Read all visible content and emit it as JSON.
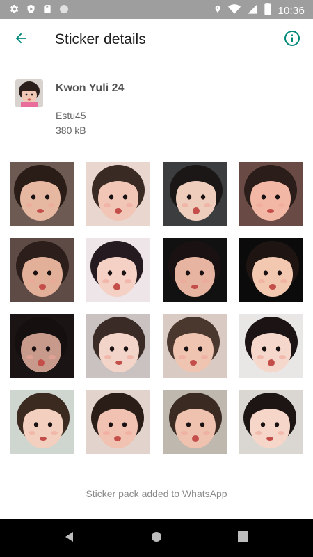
{
  "status_bar": {
    "time": "10:36",
    "left_icons": [
      "gear-icon",
      "shield-icon",
      "sd-card-icon",
      "circle-icon"
    ],
    "right_icons": [
      "location-icon",
      "wifi-icon",
      "signal-icon",
      "battery-icon"
    ]
  },
  "app_bar": {
    "title": "Sticker details",
    "back_icon": "arrow-left-icon",
    "info_icon": "info-icon",
    "accent_color": "#00897b"
  },
  "pack": {
    "name": "Kwon Yuli 24",
    "publisher": "Estu45",
    "size": "380 kB"
  },
  "stickers": [
    {
      "id": 1,
      "bg": "#6d5a52",
      "hair": "#2a1c17",
      "skin": "#e6b7a1"
    },
    {
      "id": 2,
      "bg": "#e8d6cf",
      "hair": "#3a2a24",
      "skin": "#f1c6b6"
    },
    {
      "id": 3,
      "bg": "#3b3d3f",
      "hair": "#1b1716",
      "skin": "#efcdbc"
    },
    {
      "id": 4,
      "bg": "#6a4a44",
      "hair": "#2b1d1a",
      "skin": "#f3b8a5"
    },
    {
      "id": 5,
      "bg": "#5e4b45",
      "hair": "#2c1e1a",
      "skin": "#e2af98"
    },
    {
      "id": 6,
      "bg": "#ede5e8",
      "hair": "#241a20",
      "skin": "#f4d0c5"
    },
    {
      "id": 7,
      "bg": "#111111",
      "hair": "#1a1212",
      "skin": "#e6b4a0"
    },
    {
      "id": 8,
      "bg": "#0b0b0b",
      "hair": "#1e1512",
      "skin": "#f2c8b0"
    },
    {
      "id": 9,
      "bg": "#1a1414",
      "hair": "#160f0f",
      "skin": "#c79a8c"
    },
    {
      "id": 10,
      "bg": "#c9c2c0",
      "hair": "#3a2b26",
      "skin": "#f3d4c8"
    },
    {
      "id": 11,
      "bg": "#d9cbc3",
      "hair": "#4a372e",
      "skin": "#efc4b0"
    },
    {
      "id": 12,
      "bg": "#e9e6e6",
      "hair": "#1c1414",
      "skin": "#f6d7cb"
    },
    {
      "id": 13,
      "bg": "#cfd6cf",
      "hair": "#3b2a20",
      "skin": "#f2cfbe"
    },
    {
      "id": 14,
      "bg": "#e2d4cc",
      "hair": "#2a1d18",
      "skin": "#f1c1b2"
    },
    {
      "id": 15,
      "bg": "#bfb8ae",
      "hair": "#3a2a22",
      "skin": "#eec2ae"
    },
    {
      "id": 16,
      "bg": "#dad7d2",
      "hair": "#1d1514",
      "skin": "#f5d6c8"
    }
  ],
  "footer": {
    "status_text": "Sticker pack added to WhatsApp"
  },
  "nav_bar": {
    "icons": [
      "back-triangle-icon",
      "home-circle-icon",
      "recents-square-icon"
    ]
  }
}
